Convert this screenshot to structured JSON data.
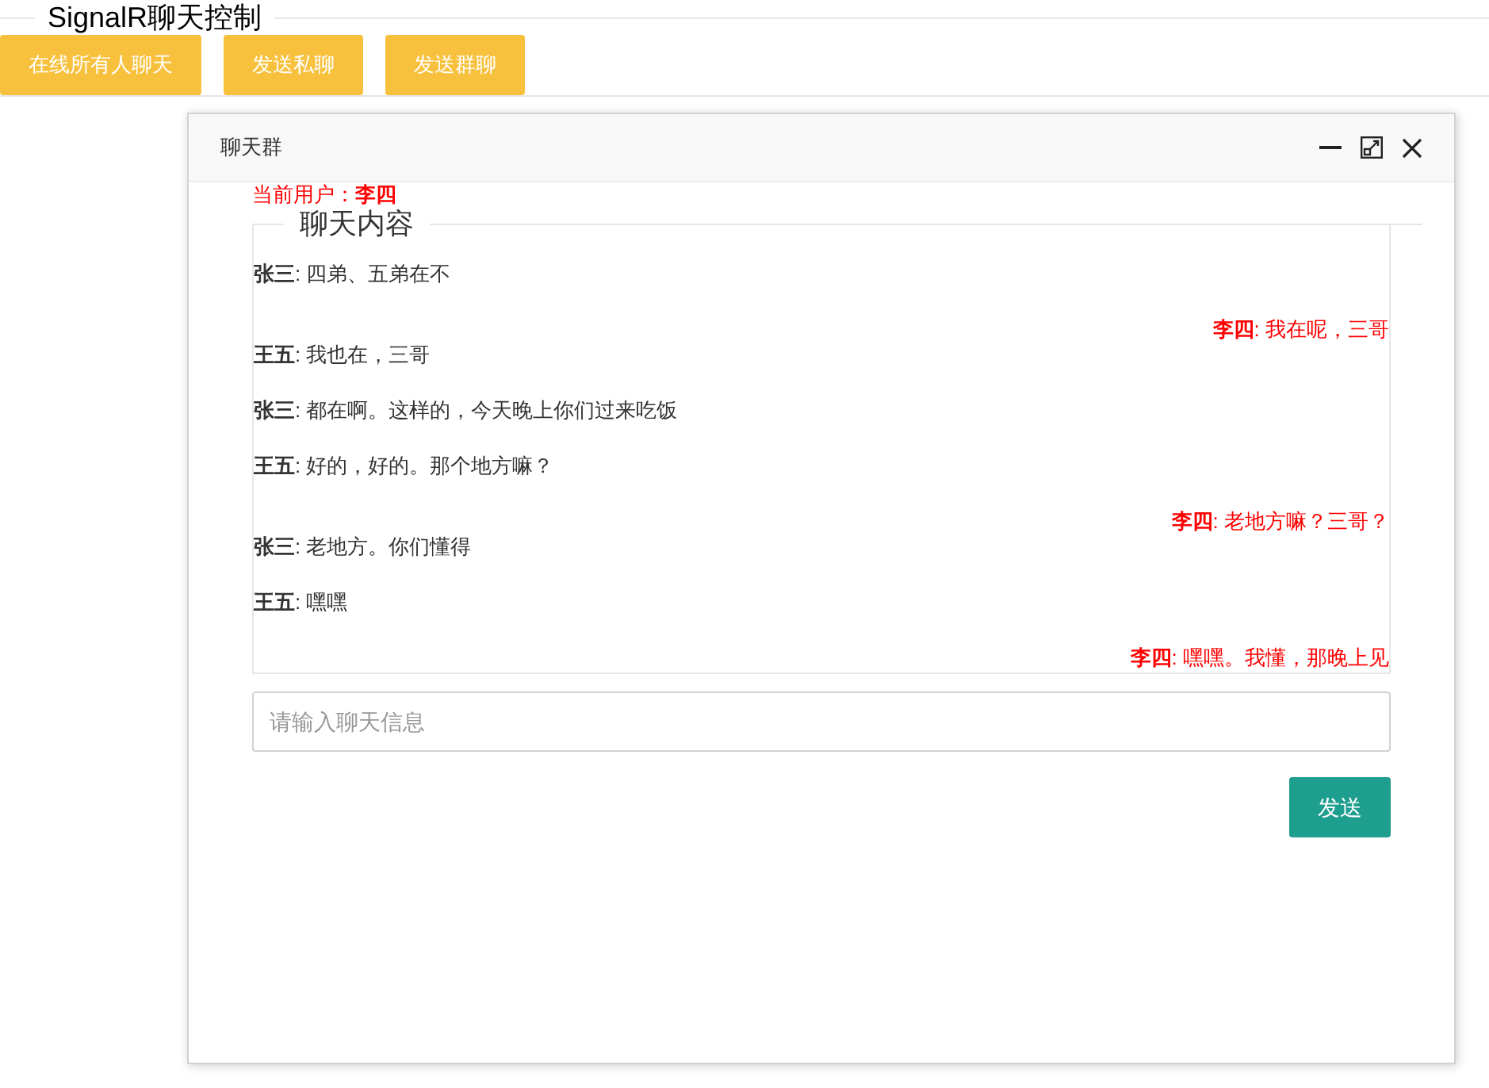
{
  "page_title": "SignalR聊天控制",
  "buttons": [
    "在线所有人聊天",
    "发送私聊",
    "发送群聊"
  ],
  "dialog": {
    "title": "聊天群",
    "current_user": "当前用户：**李四**",
    "section_title": "聊天内容",
    "messages": [
      {
        "kind": "other",
        "text": "**张三**: 四弟、五弟在不"
      },
      {
        "kind": "self",
        "text": "**李四**: 我在呢，三哥"
      },
      {
        "kind": "other",
        "text": "**王五**: 我也在，三哥"
      },
      {
        "kind": "other",
        "text": "**张三**: 都在啊。这样的，今天晚上你们过来吃饭"
      },
      {
        "kind": "other",
        "text": "**王五**: 好的，好的。那个地方嘛？"
      },
      {
        "kind": "self",
        "text": "**李四**: 老地方嘛？三哥？"
      },
      {
        "kind": "other",
        "text": "**张三**: 老地方。你们懂得"
      },
      {
        "kind": "other",
        "text": "**王五**: 嘿嘿"
      },
      {
        "kind": "self",
        "text": "**李四**: 嘿嘿。我懂，那晚上见"
      }
    ],
    "input": {
      "placeholder": "请输入聊天信息"
    },
    "send_button": "发送"
  }
}
